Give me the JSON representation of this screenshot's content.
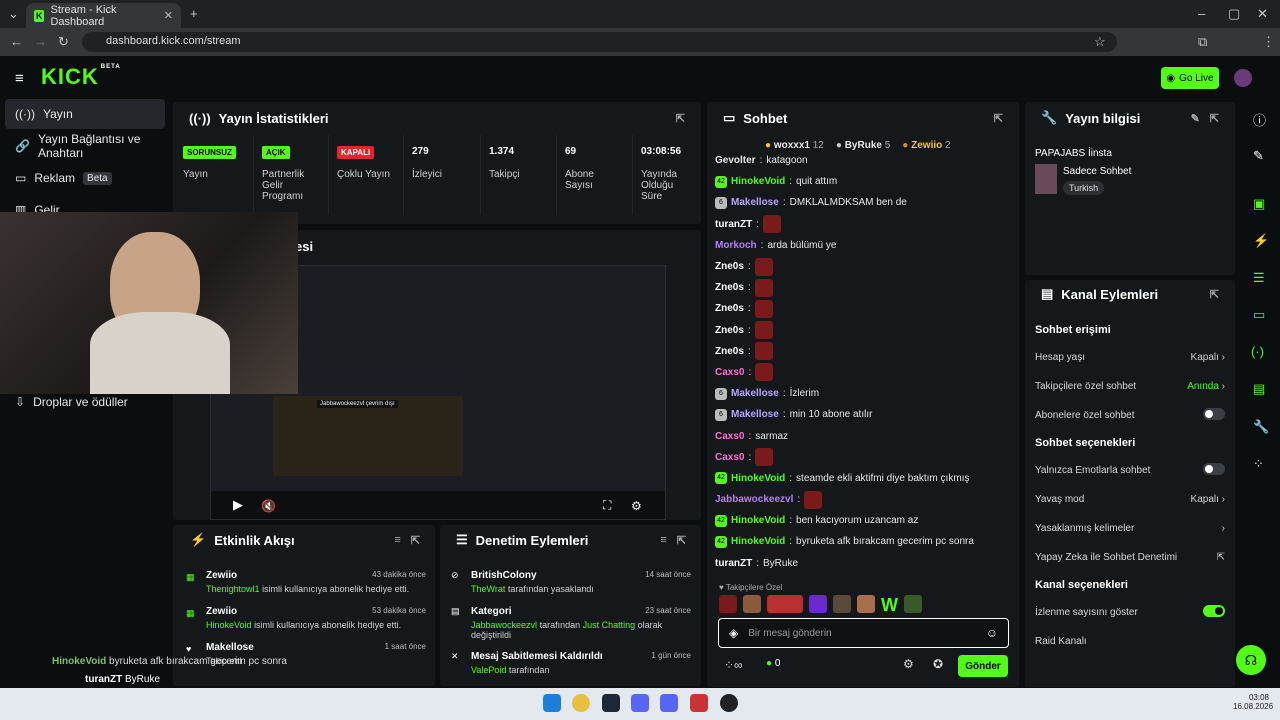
{
  "browser": {
    "tab_title": "Stream - Kick Dashboard",
    "url": "dashboard.kick.com/stream"
  },
  "header": {
    "logo": "KICK",
    "logo_badge": "BETA",
    "go_live": "Go Live"
  },
  "sidebar": {
    "items": [
      {
        "label": "Yayın"
      },
      {
        "label": "Yayın Bağlantısı ve Anahtarı"
      },
      {
        "label": "Reklam",
        "badge": "Beta"
      },
      {
        "label": "Gelir"
      },
      {
        "label": "Droplar ve ödüller"
      }
    ]
  },
  "stats": {
    "title": "Yayın İstatistikleri",
    "cells": [
      {
        "pill": "SORUNSUZ",
        "label": "Yayın"
      },
      {
        "pill": "AÇIK",
        "label": "Partnerlik Gelir Programı"
      },
      {
        "pill": "KAPALI",
        "label": "Çoklu Yayın"
      },
      {
        "value": "279",
        "label": "İzleyici"
      },
      {
        "value": "1.374",
        "label": "Takipçi"
      },
      {
        "value": "69",
        "label": "Abone Sayısı"
      },
      {
        "value": "03:08:56",
        "label": "Yayında Olduğu Süre"
      }
    ]
  },
  "preview": {
    "title_fragment": "esi",
    "overlay_text": "Jabbawockeezvl çevrim dışı"
  },
  "activity": {
    "title": "Etkinlik Akışı",
    "items": [
      {
        "name": "Zewiio",
        "time": "43 dakika önce",
        "user": "Thenightowl1",
        "text": "isimli kullanıcıya abonelik hediye etti."
      },
      {
        "name": "Zewiio",
        "time": "53 dakika önce",
        "user": "HinokeVoid",
        "text": "isimli kullanıcıya abonelik hediye etti."
      },
      {
        "name": "Makellose",
        "time": "1 saat önce",
        "user": "",
        "text": "Takip etti"
      }
    ]
  },
  "moderation": {
    "title": "Denetim Eylemleri",
    "items": [
      {
        "name": "BritishColony",
        "time": "14 saat önce",
        "user": "TheWrat",
        "text": "tarafından yasaklandı"
      },
      {
        "name": "Kategori",
        "time": "23 saat önce",
        "user": "Jabbawockeezvl",
        "text": "tarafından",
        "extra": "Just Chatting",
        "text2": "olarak değiştirildi"
      },
      {
        "name": "Mesaj Sabitlemesi Kaldırıldı",
        "time": "1 gün önce",
        "user": "ValePoid",
        "text": "tarafından"
      }
    ]
  },
  "chat": {
    "title": "Sohbet",
    "leaders": [
      {
        "name": "woxxx1",
        "count": "12"
      },
      {
        "name": "ByRuke",
        "count": "5"
      },
      {
        "name": "Zewiio",
        "count": "2"
      }
    ],
    "messages": [
      {
        "user": "Gevolter",
        "text": "katagoon",
        "color": "#e8e8e8"
      },
      {
        "user": "HinokeVoid",
        "text": "quit attım",
        "color": "#53fc18",
        "badge": "42"
      },
      {
        "user": "Makellose",
        "text": "DMKLALMDKSAM ben de",
        "color": "#b7a6ff",
        "badge": "6"
      },
      {
        "user": "turanZT",
        "text": "",
        "color": "#ffffff",
        "emote": true
      },
      {
        "user": "Morkoch",
        "text": "arda bülümü ye",
        "color": "#b77dff"
      },
      {
        "user": "Zne0s",
        "text": "",
        "color": "#ffffff",
        "emote": true
      },
      {
        "user": "Zne0s",
        "text": "",
        "color": "#ffffff",
        "emote": true
      },
      {
        "user": "Zne0s",
        "text": "",
        "color": "#ffffff",
        "emote": true
      },
      {
        "user": "Zne0s",
        "text": "",
        "color": "#ffffff",
        "emote": true
      },
      {
        "user": "Zne0s",
        "text": "",
        "color": "#ffffff",
        "emote": true
      },
      {
        "user": "Caxs0",
        "text": "",
        "color": "#ff6fd8",
        "emote": true
      },
      {
        "user": "Makellose",
        "text": "İzlerim",
        "color": "#b7a6ff",
        "badge": "6"
      },
      {
        "user": "Makellose",
        "text": "min 10 abone atılır",
        "color": "#b7a6ff",
        "badge": "6"
      },
      {
        "user": "Caxs0",
        "text": "sarmaz",
        "color": "#ff6fd8"
      },
      {
        "user": "Caxs0",
        "text": "",
        "color": "#ff6fd8",
        "emote": true
      },
      {
        "user": "HinokeVoid",
        "text": "steamde ekli aktifmi diye baktım çıkmış",
        "color": "#53fc18",
        "badge": "42"
      },
      {
        "user": "Jabbawockeezvl",
        "text": "",
        "color": "#b77dff",
        "emote": true
      },
      {
        "user": "HinokeVoid",
        "text": "ben kacıyorum uzancam az",
        "color": "#53fc18",
        "badge": "42"
      },
      {
        "user": "HinokeVoid",
        "text": "byruketa afk bırakcam gecerim pc sonra",
        "color": "#53fc18",
        "badge": "42"
      },
      {
        "user": "turanZT",
        "text": "ByRuke",
        "color": "#ffffff"
      }
    ],
    "followers_only": "Takipçilere Özel",
    "placeholder": "Bir mesaj gönderin",
    "points": "0",
    "send": "Gönder"
  },
  "stream_info": {
    "title": "Yayın bilgisi",
    "name": "PAPAJABS İinsta",
    "mode": "Sadece Sohbet",
    "lang": "Turkish"
  },
  "channel_actions": {
    "title": "Kanal Eylemleri",
    "section1": "Sohbet erişimi",
    "rows1": [
      {
        "label": "Hesap yaşı",
        "value": "Kapalı"
      },
      {
        "label": "Takipçilere özel sohbet",
        "value": "Anında"
      },
      {
        "label": "Abonelere özel sohbet",
        "value": ""
      }
    ],
    "section2": "Sohbet seçenekleri",
    "rows2": [
      {
        "label": "Yalnızca Emotlarla sohbet",
        "value": ""
      },
      {
        "label": "Yavaş mod",
        "value": "Kapalı"
      },
      {
        "label": "Yasaklanmış kelimeler",
        "value": ""
      },
      {
        "label": "Yapay Zeka ile Sohbet Denetimi",
        "value": ""
      }
    ],
    "section3": "Kanal seçenekleri",
    "rows3": [
      {
        "label": "İzlenme sayısını göster",
        "value": ""
      },
      {
        "label": "Raid Kanalı",
        "value": ""
      }
    ]
  },
  "overlay_chat": [
    {
      "user": "HinokeVoid",
      "text": "byruketa afk bırakcam gecerim pc sonra"
    },
    {
      "user": "turanZT",
      "text": "ByRuke"
    }
  ],
  "taskbar": {
    "time": "03:08",
    "date": "16.08.2026"
  }
}
